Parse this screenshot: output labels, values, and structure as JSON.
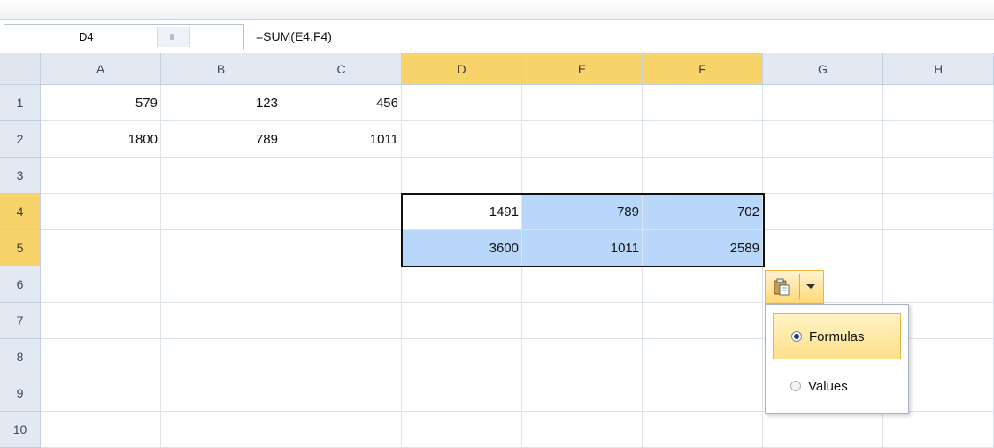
{
  "formula_bar": {
    "name_box": "D4",
    "formula": "=SUM(E4,F4)"
  },
  "columns": [
    "A",
    "B",
    "C",
    "D",
    "E",
    "F",
    "G",
    "H"
  ],
  "selected_columns": [
    "D",
    "E",
    "F"
  ],
  "rows": [
    "1",
    "2",
    "3",
    "4",
    "5",
    "6",
    "7",
    "8",
    "9",
    "10"
  ],
  "selected_rows": [
    "4",
    "5"
  ],
  "cells": {
    "A1": "579",
    "B1": "123",
    "C1": "456",
    "A2": "1800",
    "B2": "789",
    "C2": "1011",
    "D4": "1491",
    "E4": "789",
    "F4": "702",
    "D5": "3600",
    "E5": "1011",
    "F5": "2589"
  },
  "highlighted_cells": [
    "E4",
    "F4",
    "D5",
    "E5",
    "F5"
  ],
  "paste_options": {
    "icon": "clipboard-icon",
    "items": [
      {
        "label": "Formulas",
        "checked": true
      },
      {
        "label": "Values",
        "checked": false
      }
    ]
  },
  "colors": {
    "header_bg": "#e2e9f2",
    "selected_header_bg": "#f8d36a",
    "selection_fill": "#b8d7fb"
  }
}
